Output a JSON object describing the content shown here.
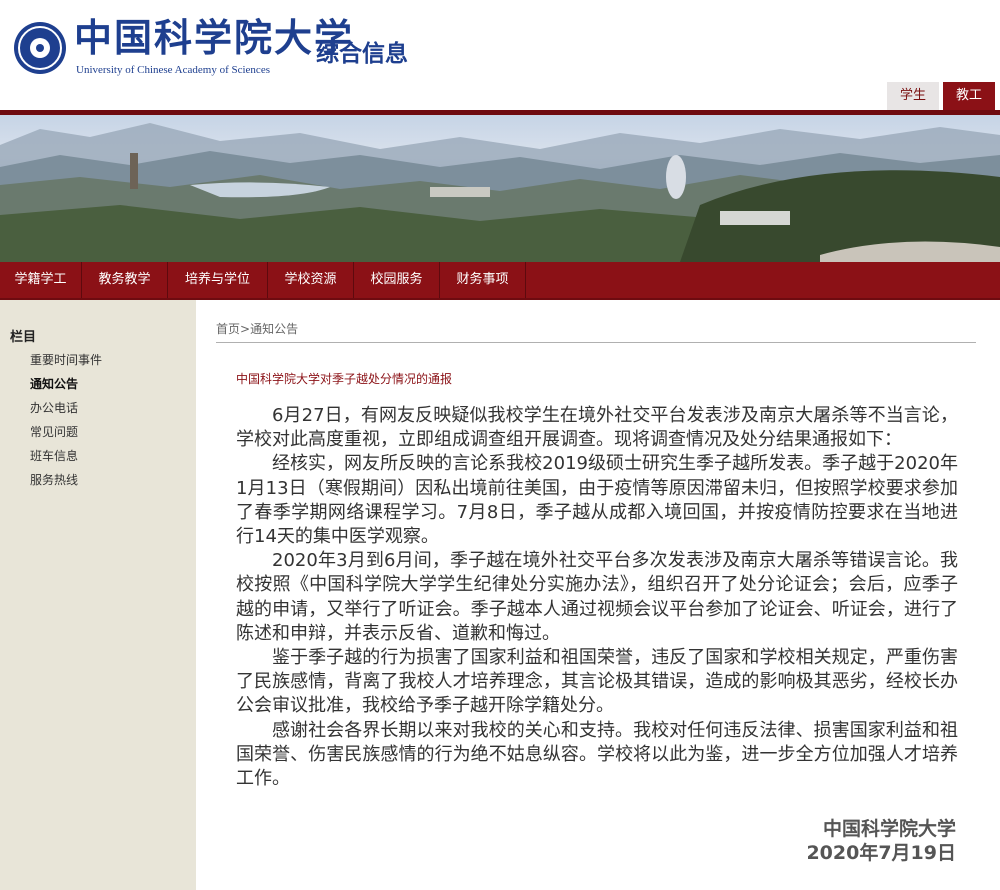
{
  "header": {
    "logo_cn": "中国科学院大学",
    "logo_en": "University of Chinese Academy of Sciences",
    "site_title": "综合信息",
    "role_tabs": [
      {
        "label": "学生"
      },
      {
        "label": "教工"
      }
    ]
  },
  "nav": {
    "items": [
      {
        "label": "学籍学工"
      },
      {
        "label": "教务教学"
      },
      {
        "label": "培养与学位"
      },
      {
        "label": "学校资源"
      },
      {
        "label": "校园服务"
      },
      {
        "label": "财务事项"
      }
    ]
  },
  "sidebar": {
    "heading": "栏目",
    "items": [
      {
        "label": "重要时间事件"
      },
      {
        "label": "通知公告"
      },
      {
        "label": "办公电话"
      },
      {
        "label": "常见问题"
      },
      {
        "label": "班车信息"
      },
      {
        "label": "服务热线"
      }
    ]
  },
  "breadcrumb": {
    "home": "首页",
    "separator": ">",
    "current": "通知公告"
  },
  "article": {
    "title": "中国科学院大学对季子越处分情况的通报",
    "paragraphs": [
      "6月27日，有网友反映疑似我校学生在境外社交平台发表涉及南京大屠杀等不当言论，学校对此高度重视，立即组成调查组开展调查。现将调查情况及处分结果通报如下：",
      "经核实，网友所反映的言论系我校2019级硕士研究生季子越所发表。季子越于2020年1月13日（寒假期间）因私出境前往美国，由于疫情等原因滞留未归，但按照学校要求参加了春季学期网络课程学习。7月8日，季子越从成都入境回国，并按疫情防控要求在当地进行14天的集中医学观察。",
      "2020年3月到6月间，季子越在境外社交平台多次发表涉及南京大屠杀等错误言论。我校按照《中国科学院大学学生纪律处分实施办法》，组织召开了处分论证会；会后，应季子越的申请，又举行了听证会。季子越本人通过视频会议平台参加了论证会、听证会，进行了陈述和申辩，并表示反省、道歉和悔过。",
      "鉴于季子越的行为损害了国家利益和祖国荣誉，违反了国家和学校相关规定，严重伤害了民族感情，背离了我校人才培养理念，其言论极其错误，造成的影响极其恶劣，经校长办公会审议批准，我校给予季子越开除学籍处分。",
      "感谢社会各界长期以来对我校的关心和支持。我校对任何违反法律、损害国家利益和祖国荣誉、伤害民族感情的行为绝不姑息纵容。学校将以此为鉴，进一步全方位加强人才培养工作。"
    ],
    "signature_org": "中国科学院大学",
    "signature_date": "2020年7月19日"
  },
  "colors": {
    "brand_blue": "#1e3f8f",
    "brand_red": "#8b1116",
    "sidebar_bg": "#e8e5d8"
  }
}
